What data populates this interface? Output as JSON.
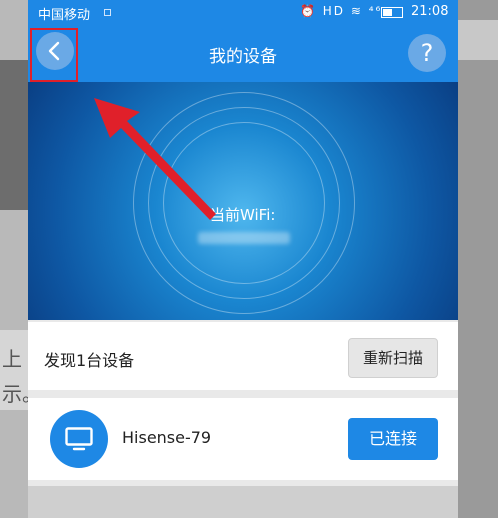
{
  "status_bar": {
    "carrier": "中国移动",
    "time": "21:08",
    "icons": "⏰ HD ≋ ⁴⁶"
  },
  "navbar": {
    "title": "我的设备",
    "help": "?"
  },
  "hero": {
    "wifi_label": "当前WiFi:"
  },
  "found": {
    "text": "发现1台设备",
    "rescan_label": "重新扫描"
  },
  "devices": [
    {
      "name": "Hisense-79",
      "status_label": "已连接"
    }
  ],
  "background": {
    "left_text_1": "上",
    "left_text_2": "示。"
  },
  "colors": {
    "primary": "#1e88e5",
    "annotation": "#e0202a"
  }
}
